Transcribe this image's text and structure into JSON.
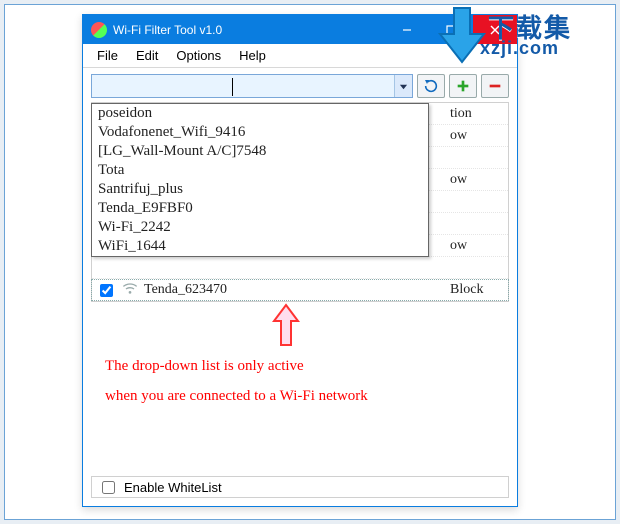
{
  "window": {
    "title": "Wi-Fi Filter Tool v1.0"
  },
  "menu": {
    "file": "File",
    "edit": "Edit",
    "options": "Options",
    "help": "Help"
  },
  "toolbar": {
    "combo_value": "",
    "combo_placeholder": ""
  },
  "dropdown": {
    "items": [
      "poseidon",
      "Vodafonenet_Wifi_9416",
      "[LG_Wall-Mount A/C]7548",
      "Tota",
      "Santrifuj_plus",
      "Tenda_E9FBF0",
      "Wi-Fi_2242",
      "WiFi_1644"
    ]
  },
  "list_bg": {
    "partial_action_1": "tion",
    "partial_action_2": "ow",
    "partial_action_3": "ow",
    "partial_action_4": "ow",
    "visible_row": {
      "ssid": "Tenda_623470",
      "action": "Block",
      "checked": true
    }
  },
  "annotation": {
    "line1": "The drop-down list  is only active",
    "line2": "when you are connected to a Wi-Fi network"
  },
  "footer": {
    "whitelist_label": "Enable WhiteList",
    "whitelist_checked": false
  },
  "watermark": {
    "cn": "下载集",
    "domain": "xzji.com"
  }
}
